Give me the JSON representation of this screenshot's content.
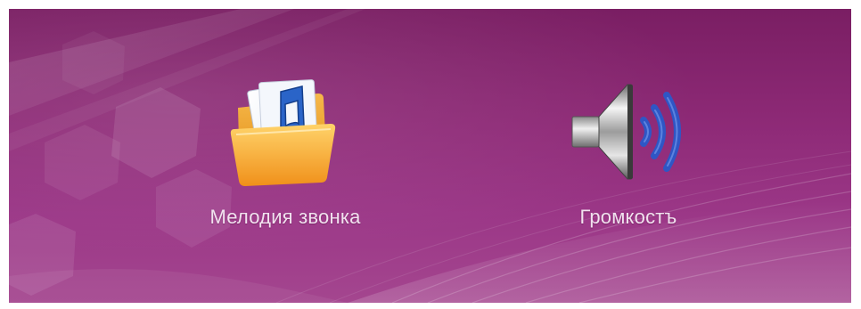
{
  "menu": {
    "items": [
      {
        "label": "Мелодия звонка",
        "icon": "music-folder-icon"
      },
      {
        "label": "Громкостъ",
        "icon": "speaker-volume-icon"
      }
    ]
  },
  "colors": {
    "background_top": "#7a1e63",
    "background_bottom": "#a4468f",
    "label_text": "#f1e2ef",
    "folder_orange": "#f2a21c",
    "note_blue": "#2a64c8",
    "wave_blue": "#2f56c5"
  }
}
